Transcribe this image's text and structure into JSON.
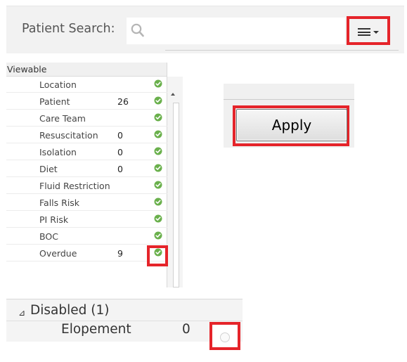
{
  "search": {
    "label": "Patient Search:",
    "placeholder": "",
    "value": "",
    "menu_icon": "hamburger-menu-icon"
  },
  "viewable": {
    "header": "Viewable",
    "items": [
      {
        "name": "Location",
        "count": "",
        "checked": true
      },
      {
        "name": "Patient",
        "count": "26",
        "checked": true
      },
      {
        "name": "Care Team",
        "count": "",
        "checked": true
      },
      {
        "name": "Resuscitation",
        "count": "0",
        "checked": true
      },
      {
        "name": "Isolation",
        "count": "0",
        "checked": true
      },
      {
        "name": "Diet",
        "count": "0",
        "checked": true
      },
      {
        "name": "Fluid Restriction",
        "count": "",
        "checked": true
      },
      {
        "name": "Falls Risk",
        "count": "",
        "checked": true
      },
      {
        "name": "PI Risk",
        "count": "",
        "checked": true
      },
      {
        "name": "BOC",
        "count": "",
        "checked": true
      },
      {
        "name": "Overdue",
        "count": "9",
        "checked": true
      }
    ]
  },
  "apply": {
    "label": "Apply"
  },
  "disabled": {
    "toggle": "⊿",
    "label": "Disabled (1)",
    "items": [
      {
        "name": "Elopement",
        "count": "0",
        "checked": false
      }
    ]
  },
  "colors": {
    "highlight": "#e5242a",
    "check": "#6ab04c"
  }
}
